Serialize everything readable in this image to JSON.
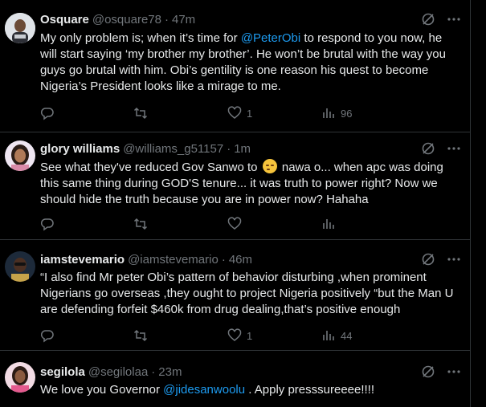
{
  "tweets": [
    {
      "name": "Osquare",
      "handle": "@osquare78",
      "time": "47m",
      "segments": [
        {
          "text": "My only problem is; when it’s time for "
        },
        {
          "text": "@PeterObi",
          "mention": true
        },
        {
          "text": " to respond to you now, he will start saying ‘my brother my brother’. He won’t be brutal with the way you guys go brutal with him. Obi’s gentility is one reason his quest to become Nigeria’s President looks like a mirage to me."
        }
      ],
      "replies": "",
      "reposts": "",
      "likes": "1",
      "views": "96"
    },
    {
      "name": "glory williams",
      "handle": "@williams_g51157",
      "time": "1m",
      "segments": [
        {
          "text": "See what they've reduced Gov Sanwo to "
        },
        {
          "emoji": "unamused-face"
        },
        {
          "text": " nawa o... when apc was doing this same thing during GOD'S tenure... it was truth to power right? Now we should hide the truth because you are in power now? Hahaha"
        }
      ],
      "replies": "",
      "reposts": "",
      "likes": "",
      "views": ""
    },
    {
      "name": "iamstevemario",
      "handle": "@iamstevemario",
      "time": "46m",
      "segments": [
        {
          "text": "“I also find Mr peter Obi’s pattern of behavior disturbing ,when prominent Nigerians go overseas ,they ought to project Nigeria positively “but the Man U are defending forfeit $460k from drug dealing,that’s positive enough"
        }
      ],
      "replies": "",
      "reposts": "",
      "likes": "1",
      "views": "44"
    },
    {
      "name": "segilola",
      "handle": "@segilolaa",
      "time": "23m",
      "segments": [
        {
          "text": "We love you Governor "
        },
        {
          "text": "@jidesanwoolu",
          "mention": true
        },
        {
          "text": " . Apply presssureeee!!!!"
        }
      ],
      "replies": "",
      "reposts": "",
      "likes": "",
      "views": ""
    }
  ],
  "dot": "·",
  "colors": {
    "background": "#000000",
    "text": "#e7e9ea",
    "muted": "#71767b",
    "accent": "#1d9bf0",
    "border": "#2f3336"
  },
  "icons": [
    "grok-icon",
    "more-icon",
    "reply-icon",
    "repost-icon",
    "like-icon",
    "views-icon"
  ]
}
